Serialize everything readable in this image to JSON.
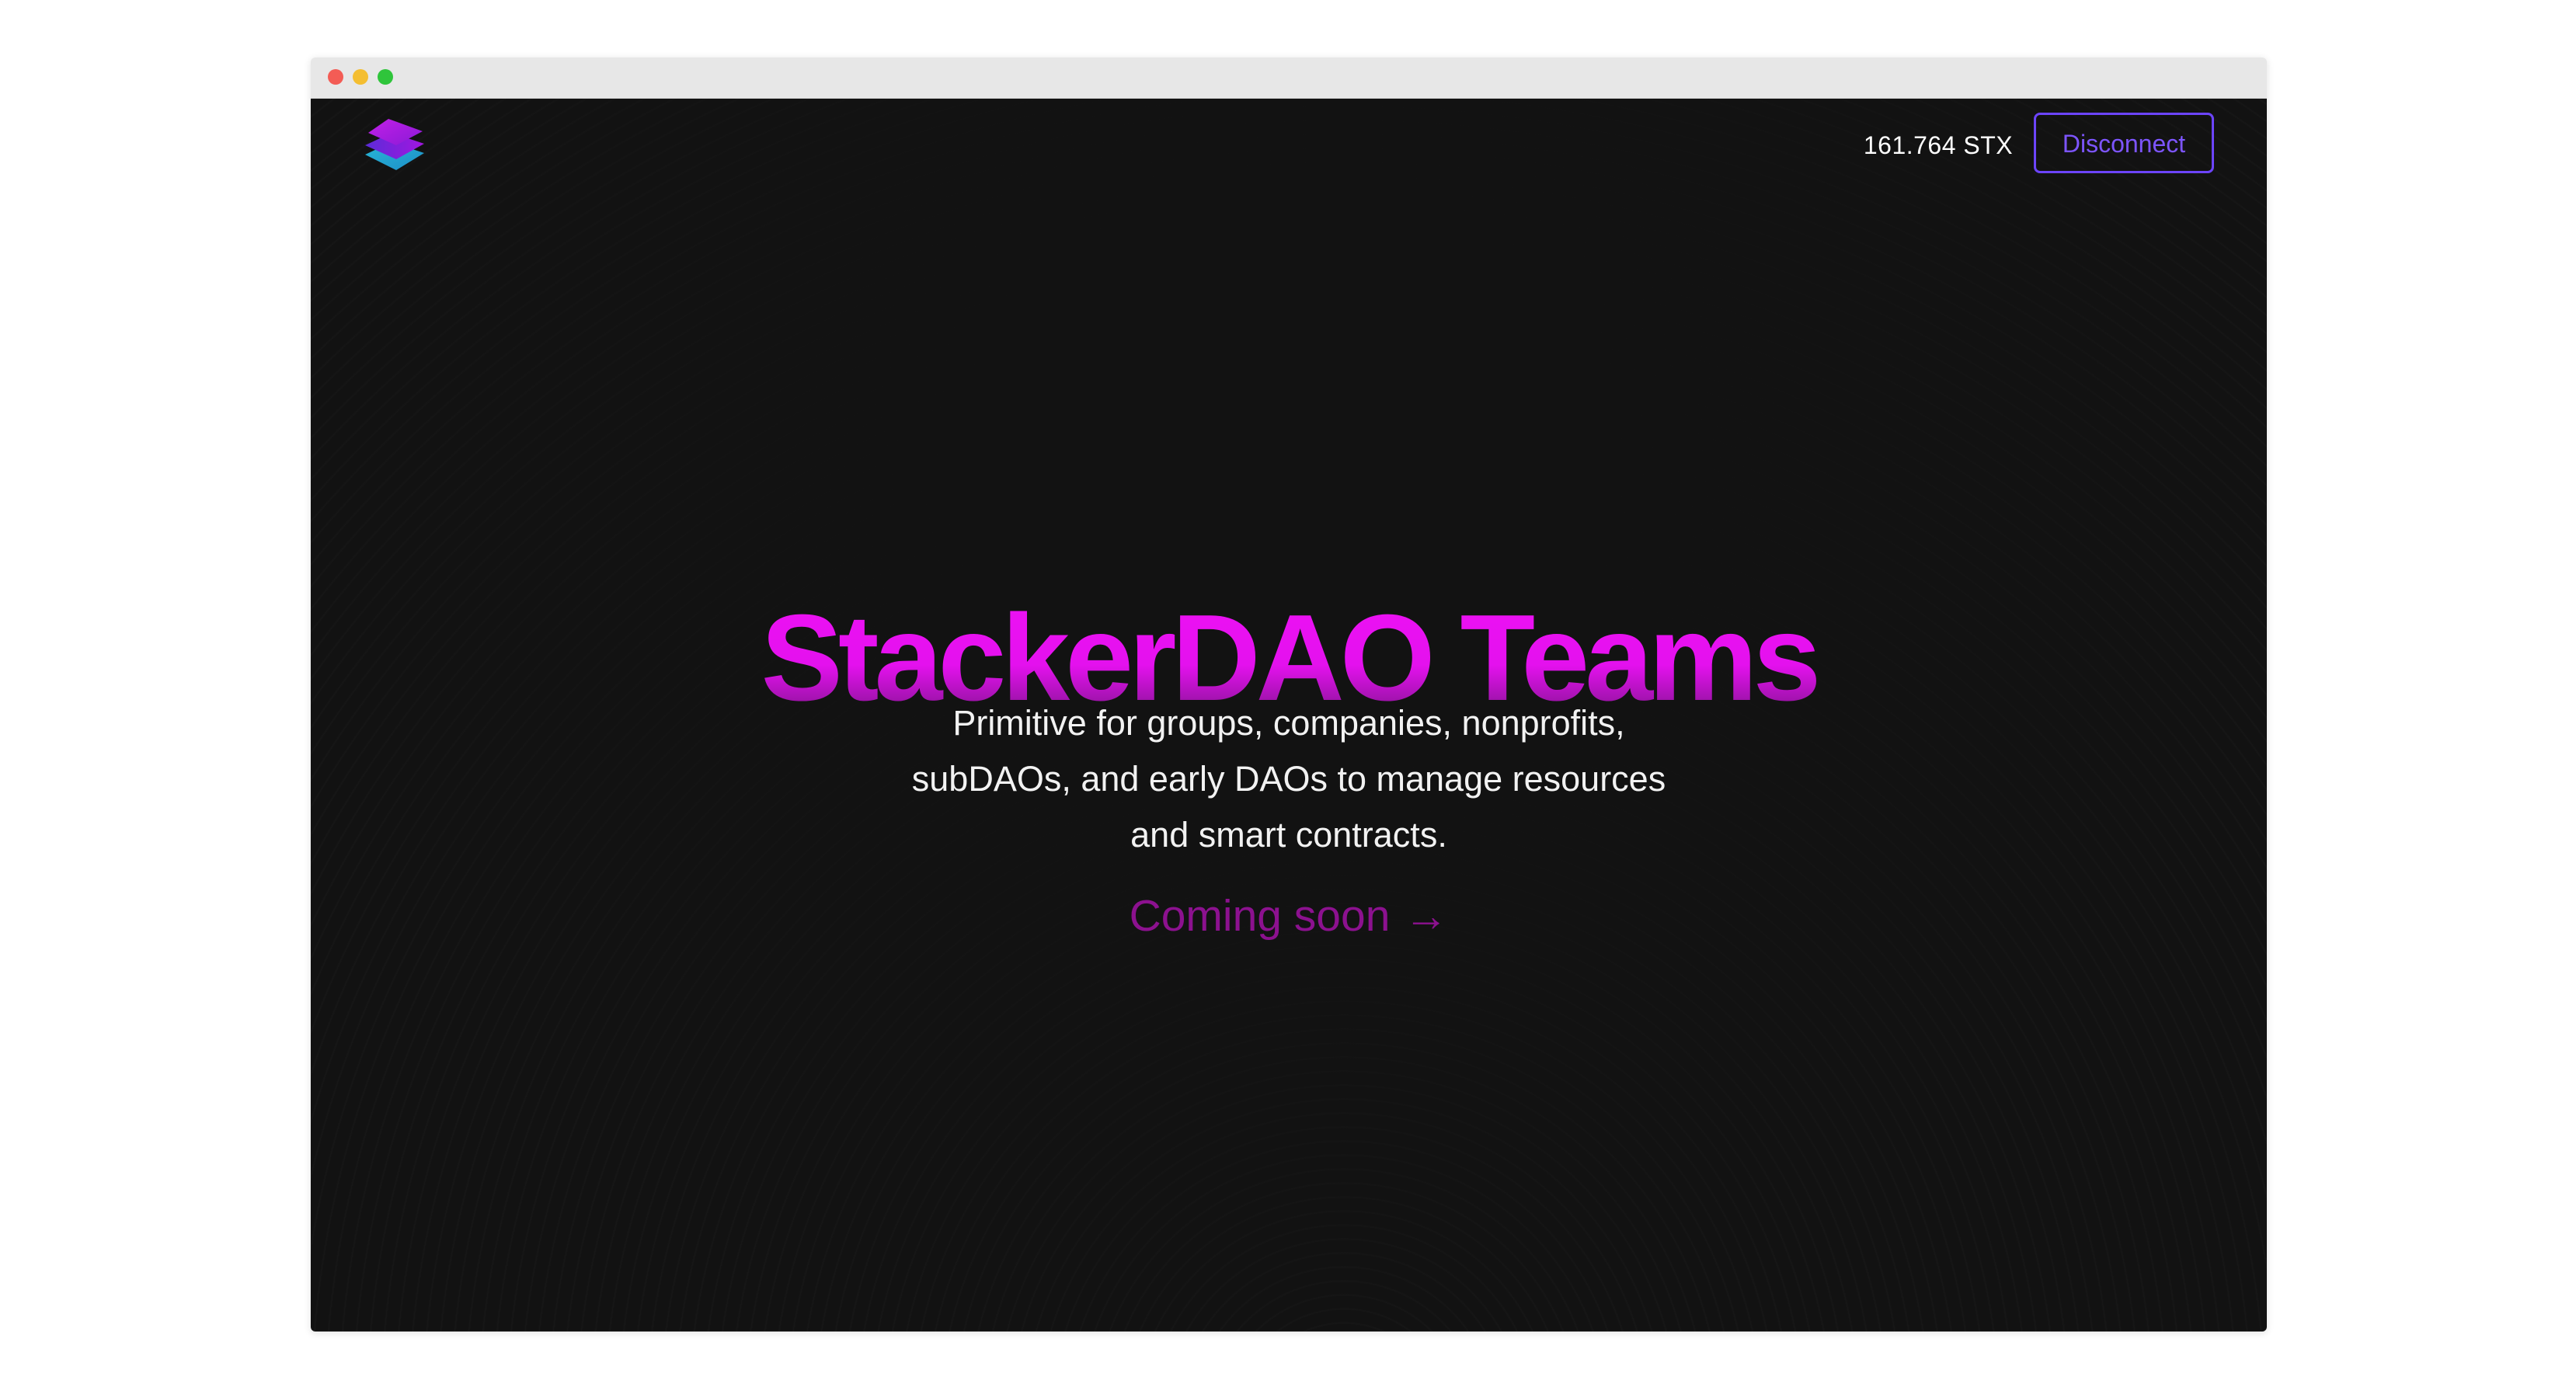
{
  "header": {
    "logo": "stackerdao-logo",
    "balance": "161.764 STX",
    "disconnect_label": "Disconnect"
  },
  "hero": {
    "title": "StackerDAO Teams",
    "subtitle_line1": "Primitive for groups, companies, nonprofits,",
    "subtitle_line2": "subDAOs, and early DAOs to manage resources",
    "subtitle_line3": "and smart contracts.",
    "cta_label": "Coming soon",
    "cta_arrow": "→"
  },
  "colors": {
    "background": "#121212",
    "title_accent": "#ee11f5",
    "button_border": "#6c44ff",
    "cta": "#8c118f"
  }
}
